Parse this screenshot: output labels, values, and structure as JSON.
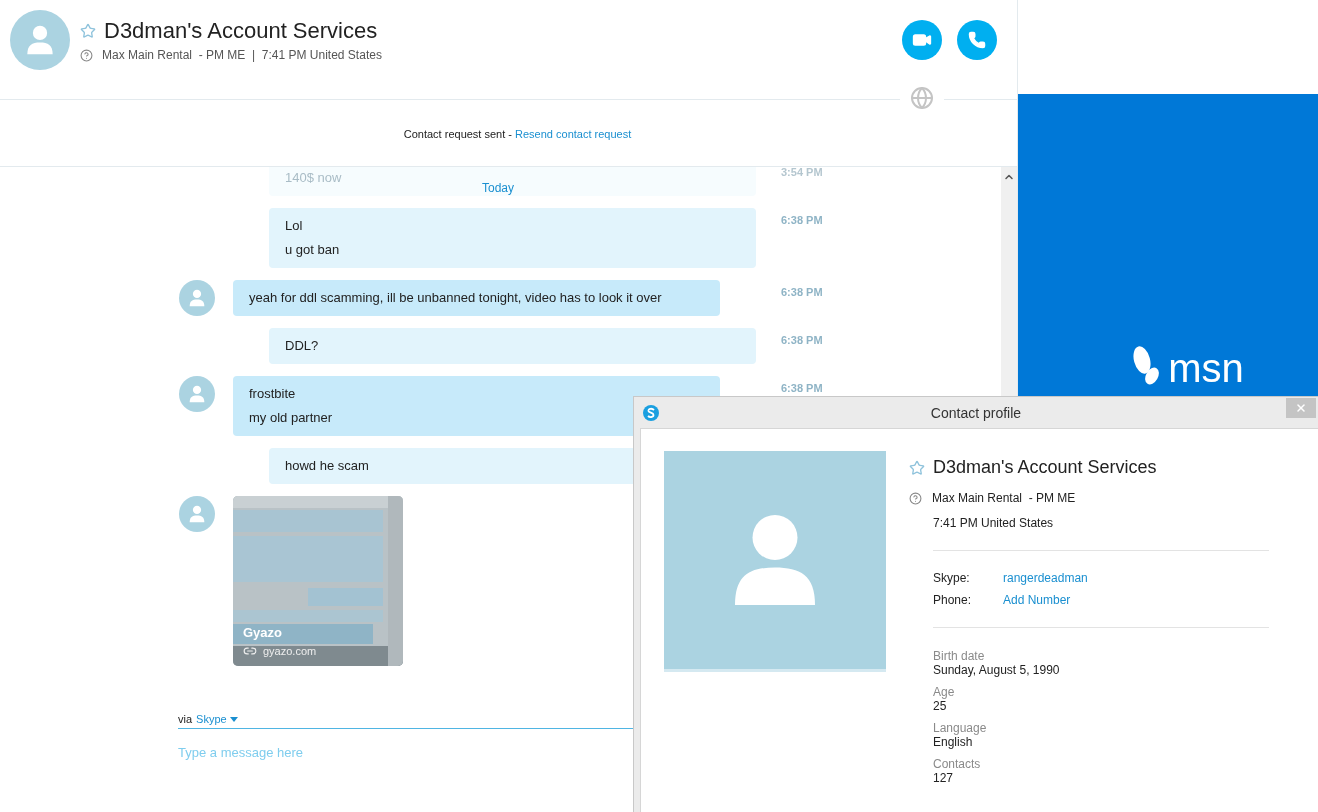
{
  "header": {
    "title": "D3dman's Account Services",
    "status": "Max Main Rental  - PM ME  |  7:41 PM United States"
  },
  "notice": {
    "text": "Contact request sent - ",
    "link": "Resend contact request"
  },
  "date_divider": "Today",
  "messages": [
    {
      "kind": "faded",
      "lines": [
        "140$ now"
      ],
      "time": "3:54 PM"
    },
    {
      "kind": "sent",
      "lines": [
        "Lol",
        "u got ban"
      ],
      "time": "6:38 PM"
    },
    {
      "kind": "received",
      "lines": [
        "yeah for ddl scamming, ill be unbanned tonight, video has to look it over"
      ],
      "time": "6:38 PM"
    },
    {
      "kind": "sent",
      "lines": [
        "DDL?"
      ],
      "time": "6:38 PM"
    },
    {
      "kind": "received",
      "lines": [
        "frostbite",
        "my old partner"
      ],
      "time": "6:38 PM"
    },
    {
      "kind": "sent",
      "lines": [
        "howd he scam"
      ]
    },
    {
      "kind": "link_preview",
      "title": "Gyazo",
      "domain": "gyazo.com"
    }
  ],
  "composer": {
    "via": "via",
    "service": "Skype",
    "placeholder": "Type a message here"
  },
  "ad": {
    "logo": "msn"
  },
  "profile_dialog": {
    "title": "Contact profile",
    "name": "D3dman's Account Services",
    "mood": "Max Main Rental  - PM ME",
    "local_time": "7:41 PM United States",
    "accounts": [
      {
        "label": "Skype:",
        "value": "rangerdeadman"
      },
      {
        "label": "Phone:",
        "value": "Add Number"
      }
    ],
    "details": [
      {
        "label": "Birth date",
        "value": "Sunday, August 5, 1990"
      },
      {
        "label": "Age",
        "value": "25"
      },
      {
        "label": "Language",
        "value": "English"
      },
      {
        "label": "Contacts",
        "value": "127"
      }
    ]
  }
}
